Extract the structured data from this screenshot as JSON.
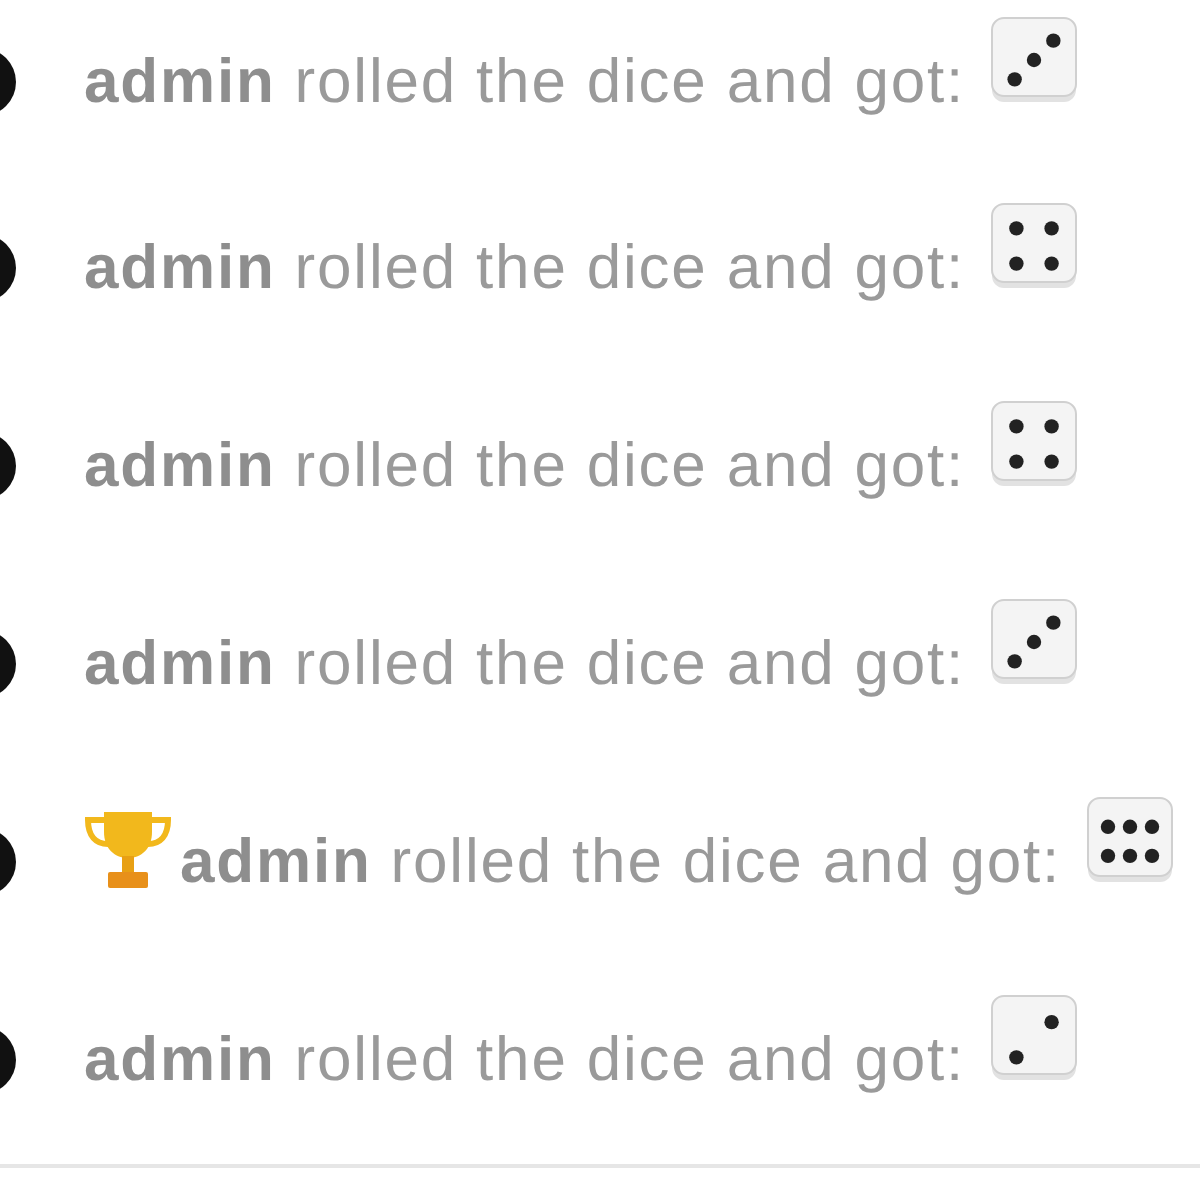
{
  "messages": [
    {
      "text": "**admin** rolled the dice and got:",
      "trophy": false,
      "kind": "three"
    },
    {
      "text": "**admin** rolled the dice and got:",
      "trophy": false,
      "kind": "four"
    },
    {
      "text": "**admin** rolled the dice and got:",
      "trophy": false,
      "kind": "four"
    },
    {
      "text": "**admin** rolled the dice and got:",
      "trophy": false,
      "kind": "three"
    },
    {
      "text": "**admin** rolled the dice and got:",
      "trophy": true,
      "kind": "six"
    },
    {
      "text": "**admin** rolled the dice and got:",
      "trophy": false,
      "kind": "two"
    }
  ]
}
